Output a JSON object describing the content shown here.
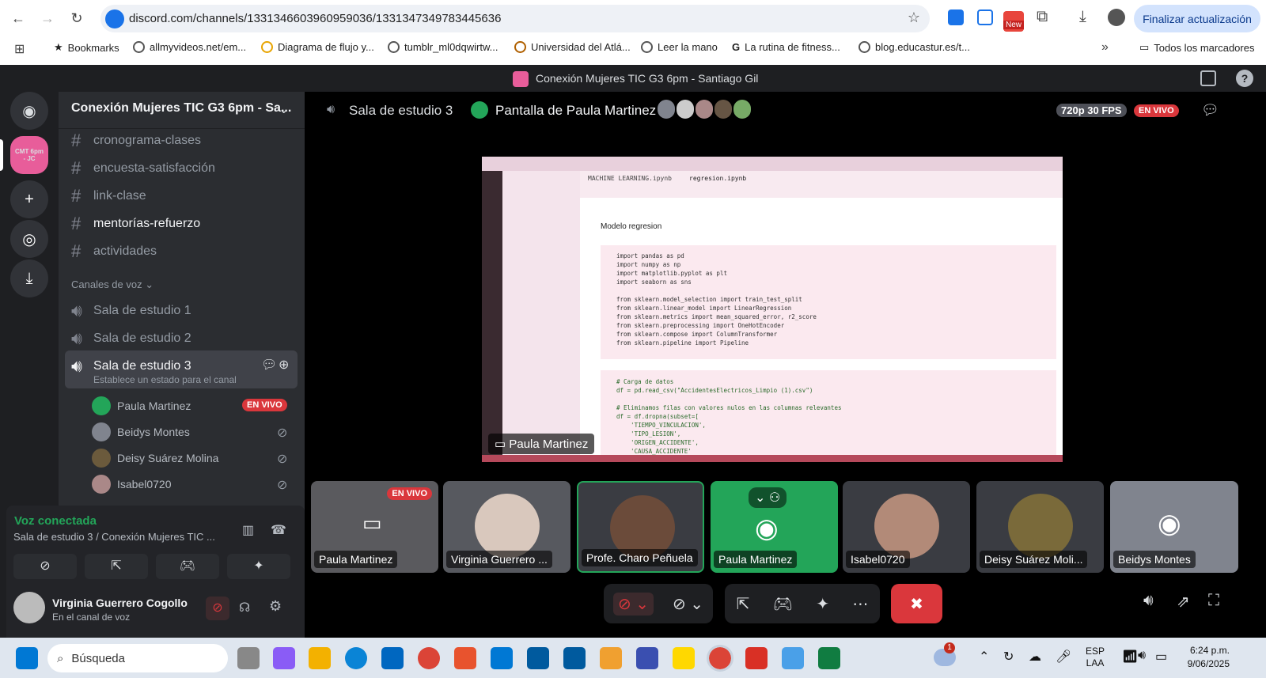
{
  "browser": {
    "url": "discord.com/channels/1331346603960959036/1331347349783445636",
    "update_label": "Finalizar actualización",
    "new_badge": "New",
    "bookmarks": [
      "Bookmarks",
      "allmyvideos.net/em...",
      "Diagrama de flujo y...",
      "tumblr_ml0dqwirtw...",
      "Universidad del Atlá...",
      "Leer la mano",
      "La rutina de fitness...",
      "blog.educastur.es/t..."
    ],
    "all_bookmarks": "Todos los marcadores"
  },
  "window_title": "Conexión Mujeres TIC G3 6pm - Santiago Gil",
  "server": {
    "name": "Conexión Mujeres TIC G3 6pm - Sa...",
    "icon_text": "CMT 6pm - JC"
  },
  "channels": [
    "cronograma-clases",
    "encuesta-satisfacción",
    "link-clase",
    "mentorías-refuerzo",
    "actividades"
  ],
  "voice": {
    "header": "Canales de voz",
    "rooms": [
      "Sala de estudio 1",
      "Sala de estudio 2",
      "Sala de estudio 3"
    ],
    "status_prompt": "Establece un estado para el canal",
    "members": [
      {
        "name": "Paula Martinez",
        "live": "EN VIVO"
      },
      {
        "name": "Beidys Montes"
      },
      {
        "name": "Deisy Suárez Molina"
      },
      {
        "name": "Isabel0720"
      }
    ]
  },
  "connection": {
    "title": "Voz conectada",
    "location": "Sala de estudio 3 / Conexión Mujeres TIC ..."
  },
  "user": {
    "name": "Virginia Guerrero Cogollo",
    "status": "En el canal de voz"
  },
  "stage": {
    "room": "Sala de estudio 3",
    "screen_title": "Pantalla de Paula Martinez",
    "quality": "720p 30 FPS",
    "live": "EN VIVO",
    "presenter": "Paula Martinez",
    "tiles": [
      {
        "name": "Paula Martinez",
        "live": "EN VIVO"
      },
      {
        "name": "Virginia Guerrero ..."
      },
      {
        "name": "Profe. Charo Peñuela"
      },
      {
        "name": "Paula Martinez"
      },
      {
        "name": "Isabel0720"
      },
      {
        "name": "Deisy Suárez Moli..."
      },
      {
        "name": "Beidys Montes"
      }
    ]
  },
  "code": {
    "tab1": "MACHINE LEARNING.ipynb",
    "tab2": "regresion.ipynb",
    "cell_title": "Modelo regresion",
    "lines1": [
      "import pandas as pd",
      "import numpy as np",
      "import matplotlib.pyplot as plt",
      "import seaborn as sns",
      "",
      "from sklearn.model_selection import train_test_split",
      "from sklearn.linear_model import LinearRegression",
      "from sklearn.metrics import mean_squared_error, r2_score",
      "from sklearn.preprocessing import OneHotEncoder",
      "from sklearn.compose import ColumnTransformer",
      "from sklearn.pipeline import Pipeline"
    ],
    "lines2": [
      "# Carga de datos",
      "df = pd.read_csv(\"AccidentesElectricos_Limpio (1).csv\")",
      "",
      "# Eliminamos filas con valores nulos en las columnas relevantes",
      "df = df.dropna(subset=[",
      "    'TIEMPO_VINCULACION',",
      "    'TIPO_LESION',",
      "    'ORIGEN_ACCIDENTE',",
      "    'CAUSA_ACCIDENTE'"
    ]
  },
  "taskbar": {
    "search": "Búsqueda",
    "lang1": "ESP",
    "lang2": "LAA",
    "time": "6:24 p.m.",
    "date": "9/06/2025",
    "notif": "1"
  }
}
